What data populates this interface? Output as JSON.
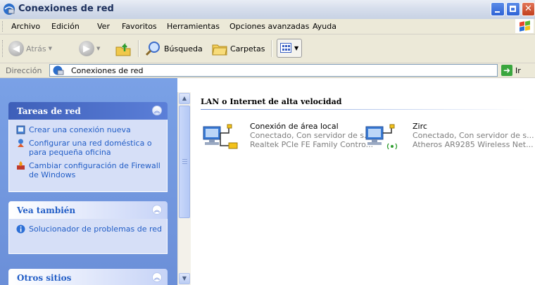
{
  "window": {
    "title": "Conexiones de red"
  },
  "menu": [
    "Archivo",
    "Edición",
    "Ver",
    "Favoritos",
    "Herramientas",
    "Opciones avanzadas",
    "Ayuda"
  ],
  "toolbar": {
    "back": "Atrás",
    "search": "Búsqueda",
    "folders": "Carpetas"
  },
  "address": {
    "label": "Dirección",
    "value": "Conexiones de red",
    "go": "Ir"
  },
  "sidebar": {
    "tasks": {
      "title": "Tareas de red",
      "items": [
        "Crear una conexión nueva",
        "Configurar una red doméstica o para pequeña oficina",
        "Cambiar configuración de Firewall de Windows"
      ]
    },
    "see_also": {
      "title": "Vea también",
      "items": [
        "Solucionador de problemas de red"
      ]
    },
    "other": {
      "title": "Otros sitios"
    }
  },
  "main": {
    "group_title": "LAN o Internet de alta velocidad",
    "connections": [
      {
        "name": "Conexión de área local",
        "status": "Conectado, Con servidor de s...",
        "device": "Realtek PCIe FE Family Contro..."
      },
      {
        "name": "Zirc",
        "status": "Conectado, Con servidor de s...",
        "device": "Atheros AR9285 Wireless Net..."
      }
    ]
  }
}
